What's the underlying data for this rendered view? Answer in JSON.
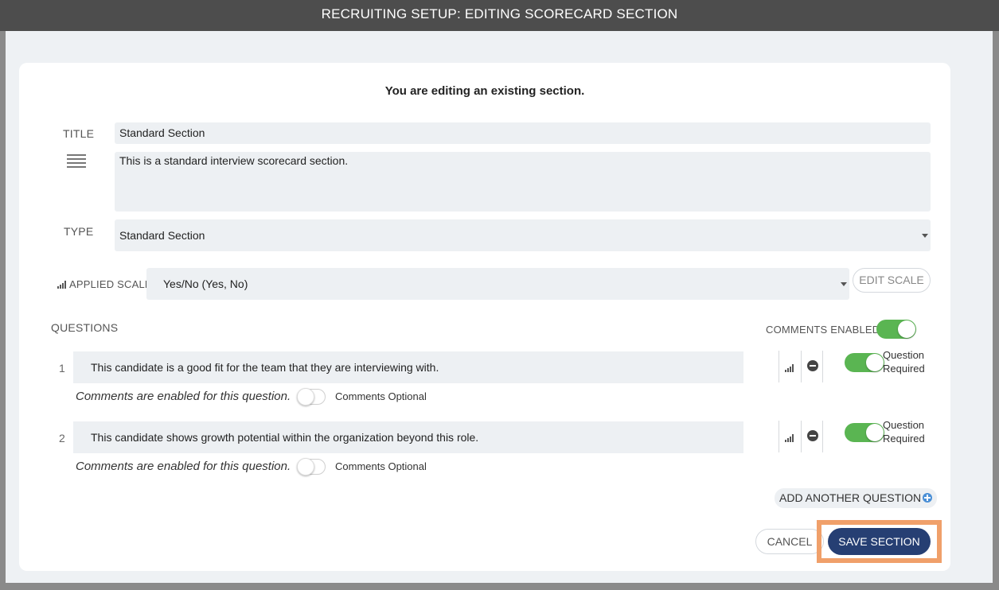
{
  "header": {
    "title": "RECRUITING SETUP: EDITING SCORECARD SECTION"
  },
  "notice": "You are editing an existing section.",
  "form": {
    "title_label": "TITLE",
    "title_value": "Standard Section",
    "description_value": "This is a standard interview scorecard section.",
    "type_label": "TYPE",
    "type_value": "Standard Section",
    "scale_label": "APPLIED SCALE",
    "scale_value": "Yes/No (Yes, No)",
    "edit_scale_label": "EDIT SCALE"
  },
  "questions": {
    "heading": "QUESTIONS",
    "comments_enabled_label": "COMMENTS ENABLED",
    "comments_enabled": true,
    "items": [
      {
        "number": "1",
        "text": "This candidate is a good fit for the team that they are interviewing with.",
        "comment_note": "Comments are enabled for this question.",
        "comments_optional_label": "Comments Optional",
        "required_label_1": "Question",
        "required_label_2": "Required"
      },
      {
        "number": "2",
        "text": "This candidate shows growth potential within the organization beyond this role.",
        "comment_note": "Comments are enabled for this question.",
        "comments_optional_label": "Comments Optional",
        "required_label_1": "Question",
        "required_label_2": "Required"
      }
    ],
    "add_label": "ADD ANOTHER QUESTION"
  },
  "actions": {
    "cancel_label": "CANCEL",
    "save_label": "SAVE SECTION"
  },
  "colors": {
    "toggle_on": "#5ab552",
    "save_button": "#263f73",
    "highlight": "#f0a06a",
    "titlebar": "#4d4d4d"
  },
  "icons": [
    "hamburger-icon",
    "scale-bars-icon",
    "remove-icon",
    "plus-circle-icon",
    "dropdown-caret-icon"
  ]
}
